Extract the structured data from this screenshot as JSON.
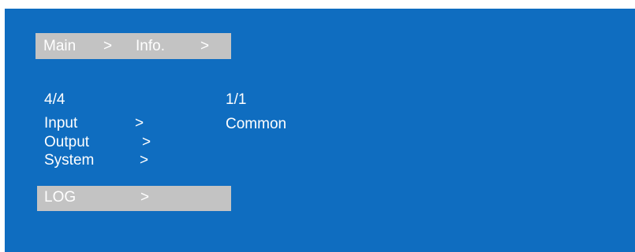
{
  "breadcrumb": {
    "main": "Main",
    "sep1": ">",
    "info": "Info.",
    "sep2": ">"
  },
  "left_panel": {
    "page_counter": "4/4",
    "items": [
      {
        "label": "Input",
        "arrow": ">"
      },
      {
        "label": "Output",
        "arrow": ">"
      },
      {
        "label": "System",
        "arrow": ">"
      },
      {
        "label": "LOG",
        "arrow": ">",
        "selected": true
      }
    ]
  },
  "right_panel": {
    "page_counter": "1/1",
    "items": [
      {
        "label": "Common"
      }
    ]
  },
  "colors": {
    "background": "#0f6dc0",
    "highlight": "#c3c3c3",
    "text": "#ffffff"
  }
}
